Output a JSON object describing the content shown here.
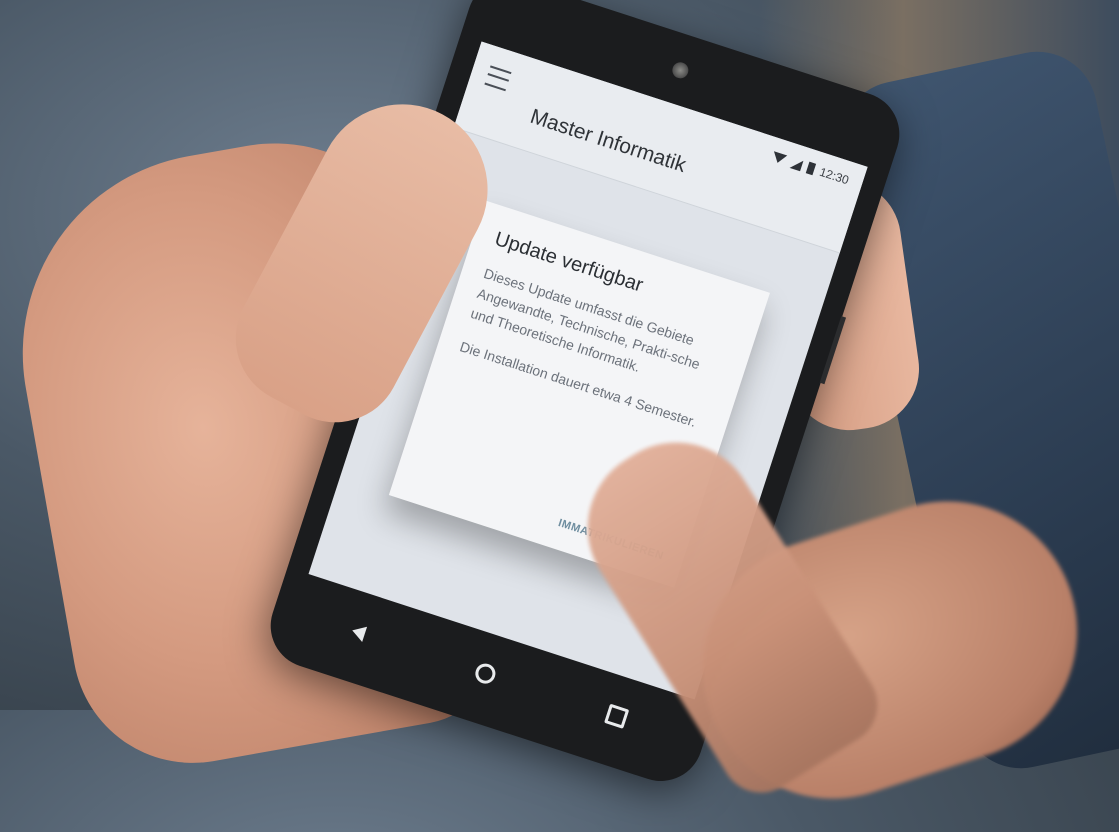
{
  "app": {
    "title": "Master Informatik",
    "status_time": "12:30"
  },
  "dialog": {
    "title": "Update verfügbar",
    "body": "Dieses Update umfasst die Gebiete Angewandte, Technische, Prakti-sche und Theoretische Informatik.",
    "body2": "Die Installation dauert etwa 4 Semester.",
    "action_label": "IMMATRIKULIEREN"
  },
  "icons": {
    "menu": "menu-icon",
    "wifi": "wifi-icon",
    "signal": "signal-icon",
    "battery": "battery-icon",
    "back": "back-icon",
    "home": "home-icon",
    "recents": "recents-icon"
  },
  "colors": {
    "screen_bg": "#dfe3e9",
    "dialog_bg": "#f4f5f7",
    "action": "#6f8ea0",
    "phone_body": "#1b1c1e"
  }
}
